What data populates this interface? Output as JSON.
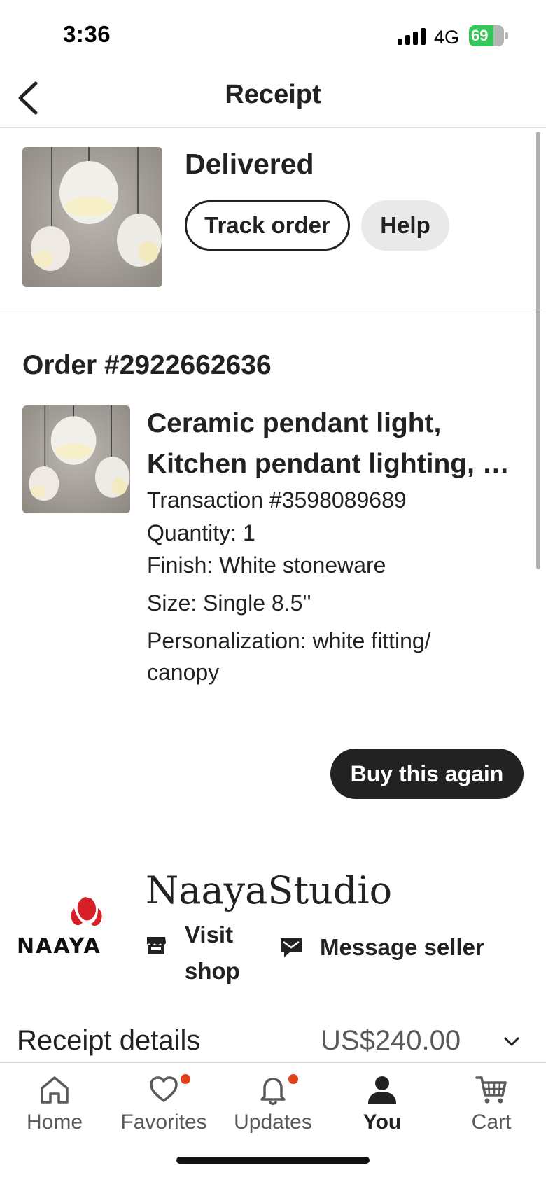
{
  "status_bar": {
    "time": "3:36",
    "network": "4G",
    "battery_percent": "69",
    "battery_level": 0.69,
    "battery_color": "#35c759"
  },
  "header": {
    "title": "Receipt",
    "back_icon": "chevron-left-icon"
  },
  "delivery": {
    "status": "Delivered",
    "track_label": "Track order",
    "help_label": "Help"
  },
  "order": {
    "number": "Order #2922662636",
    "item": {
      "title_line1": "Ceramic pendant light,",
      "title_line2": "Kitchen pendant lighting, Ceramic lamp",
      "transaction": "Transaction #3598089689",
      "quantity": "Quantity: 1",
      "finish": "Finish: White stoneware",
      "size": "Size: Single 8.5''",
      "personalization_line1": "Personalization: white fitting/",
      "personalization_line2": "canopy"
    },
    "buy_again_label": "Buy this again"
  },
  "shop": {
    "name": "NaayaStudio",
    "logo_text": "NAAYA",
    "visit_label_line1": "Visit",
    "visit_label_line2": "shop",
    "message_label": "Message seller"
  },
  "receipt": {
    "label": "Receipt details",
    "amount": "US$240.00"
  },
  "nav": {
    "items": [
      {
        "label": "Home",
        "icon": "home-icon",
        "active": false,
        "dot": false
      },
      {
        "label": "Favorites",
        "icon": "heart-icon",
        "active": false,
        "dot": true
      },
      {
        "label": "Updates",
        "icon": "bell-icon",
        "active": false,
        "dot": true
      },
      {
        "label": "You",
        "icon": "person-icon",
        "active": true,
        "dot": false
      },
      {
        "label": "Cart",
        "icon": "cart-icon",
        "active": false,
        "dot": false
      }
    ]
  },
  "colors": {
    "accent_dot": "#e0401a",
    "primary_text": "#222222",
    "secondary_text": "#595959"
  }
}
